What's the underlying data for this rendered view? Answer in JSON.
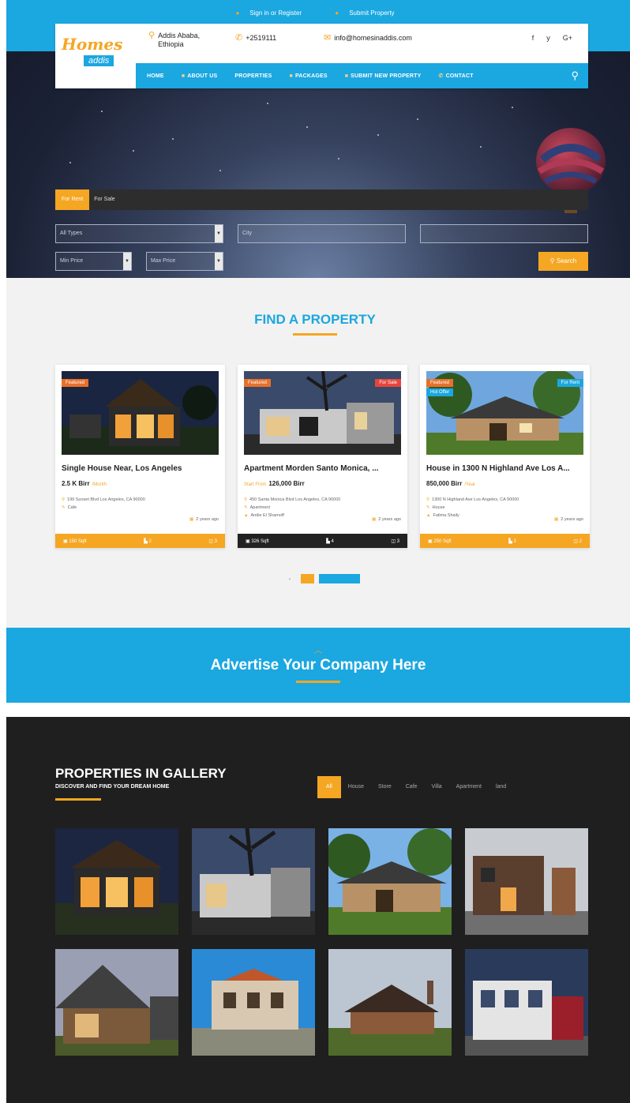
{
  "topbar": {
    "signin": "Sign in or Register",
    "submit": "Submit Property"
  },
  "logo": {
    "line1": "Homes",
    "line2": "addis"
  },
  "contact": {
    "location": "Addis Ababa, Ethiopia",
    "phone": "+2519111",
    "email": "info@homesinaddis.com"
  },
  "social": [
    "f",
    "y",
    "G+"
  ],
  "nav": [
    "HOME",
    "ABOUT US",
    "PROPERTIES",
    "PACKAGES",
    "SUBMIT NEW PROPERTY",
    "CONTACT"
  ],
  "search": {
    "tabs": [
      "For Rent",
      "For Sale"
    ],
    "type_placeholder": "All Types",
    "city_placeholder": "City",
    "keyword_placeholder": "",
    "min_price": "Min Price",
    "max_price": "Max Price",
    "button": "Search"
  },
  "find": {
    "title": "FIND A PROPERTY"
  },
  "cards": [
    {
      "badge1": "Featured",
      "badge2": "",
      "badge3": "",
      "title": "Single House Near, Los Angeles",
      "price": "2.5 K Birr",
      "price_tag": "/Month",
      "address": "199 Sunset Blvd Los Angeles, CA 90000",
      "type": "Cafe",
      "agent": "",
      "age": "2 years ago",
      "area": "150 Sqft",
      "beds": "2",
      "baths": "3"
    },
    {
      "badge1": "Featured",
      "badge2": "For Sale",
      "badge3": "",
      "title": "Apartment Morden Santo Monica, ...",
      "price": "126,000 Birr",
      "price_pre": "Start From",
      "address": "450 Santa Monica Blvd Los Angeles, CA 90000",
      "type": "Apartment",
      "agent": "Andie El Shamoff",
      "age": "2 years ago",
      "area": "326 Sqft",
      "beds": "4",
      "baths": "3"
    },
    {
      "badge1": "Featured",
      "badge2": "For Rent",
      "badge3": "Hot Offer",
      "title": "House in 1300 N Highland Ave Los A...",
      "price": "850,000 Birr",
      "price_tag": "/Year",
      "address": "1300 N Highland Ave Los Angeles, CA 90000",
      "type": "House",
      "agent": "Fatima Shaily",
      "age": "2 years ago",
      "area": "250 Sqft",
      "beds": "3",
      "baths": "2"
    }
  ],
  "advert": {
    "text": "Advertise Your Company Here"
  },
  "gallery": {
    "title": "PROPERTIES IN GALLERY",
    "subtitle": "DISCOVER AND FIND YOUR DREAM HOME",
    "filters": [
      "All",
      "House",
      "Store",
      "Cafe",
      "Villa",
      "Apartment",
      "land"
    ]
  },
  "colors": {
    "accent": "#f5a623",
    "brand": "#1ba7e0",
    "dark": "#1f1f1f"
  }
}
